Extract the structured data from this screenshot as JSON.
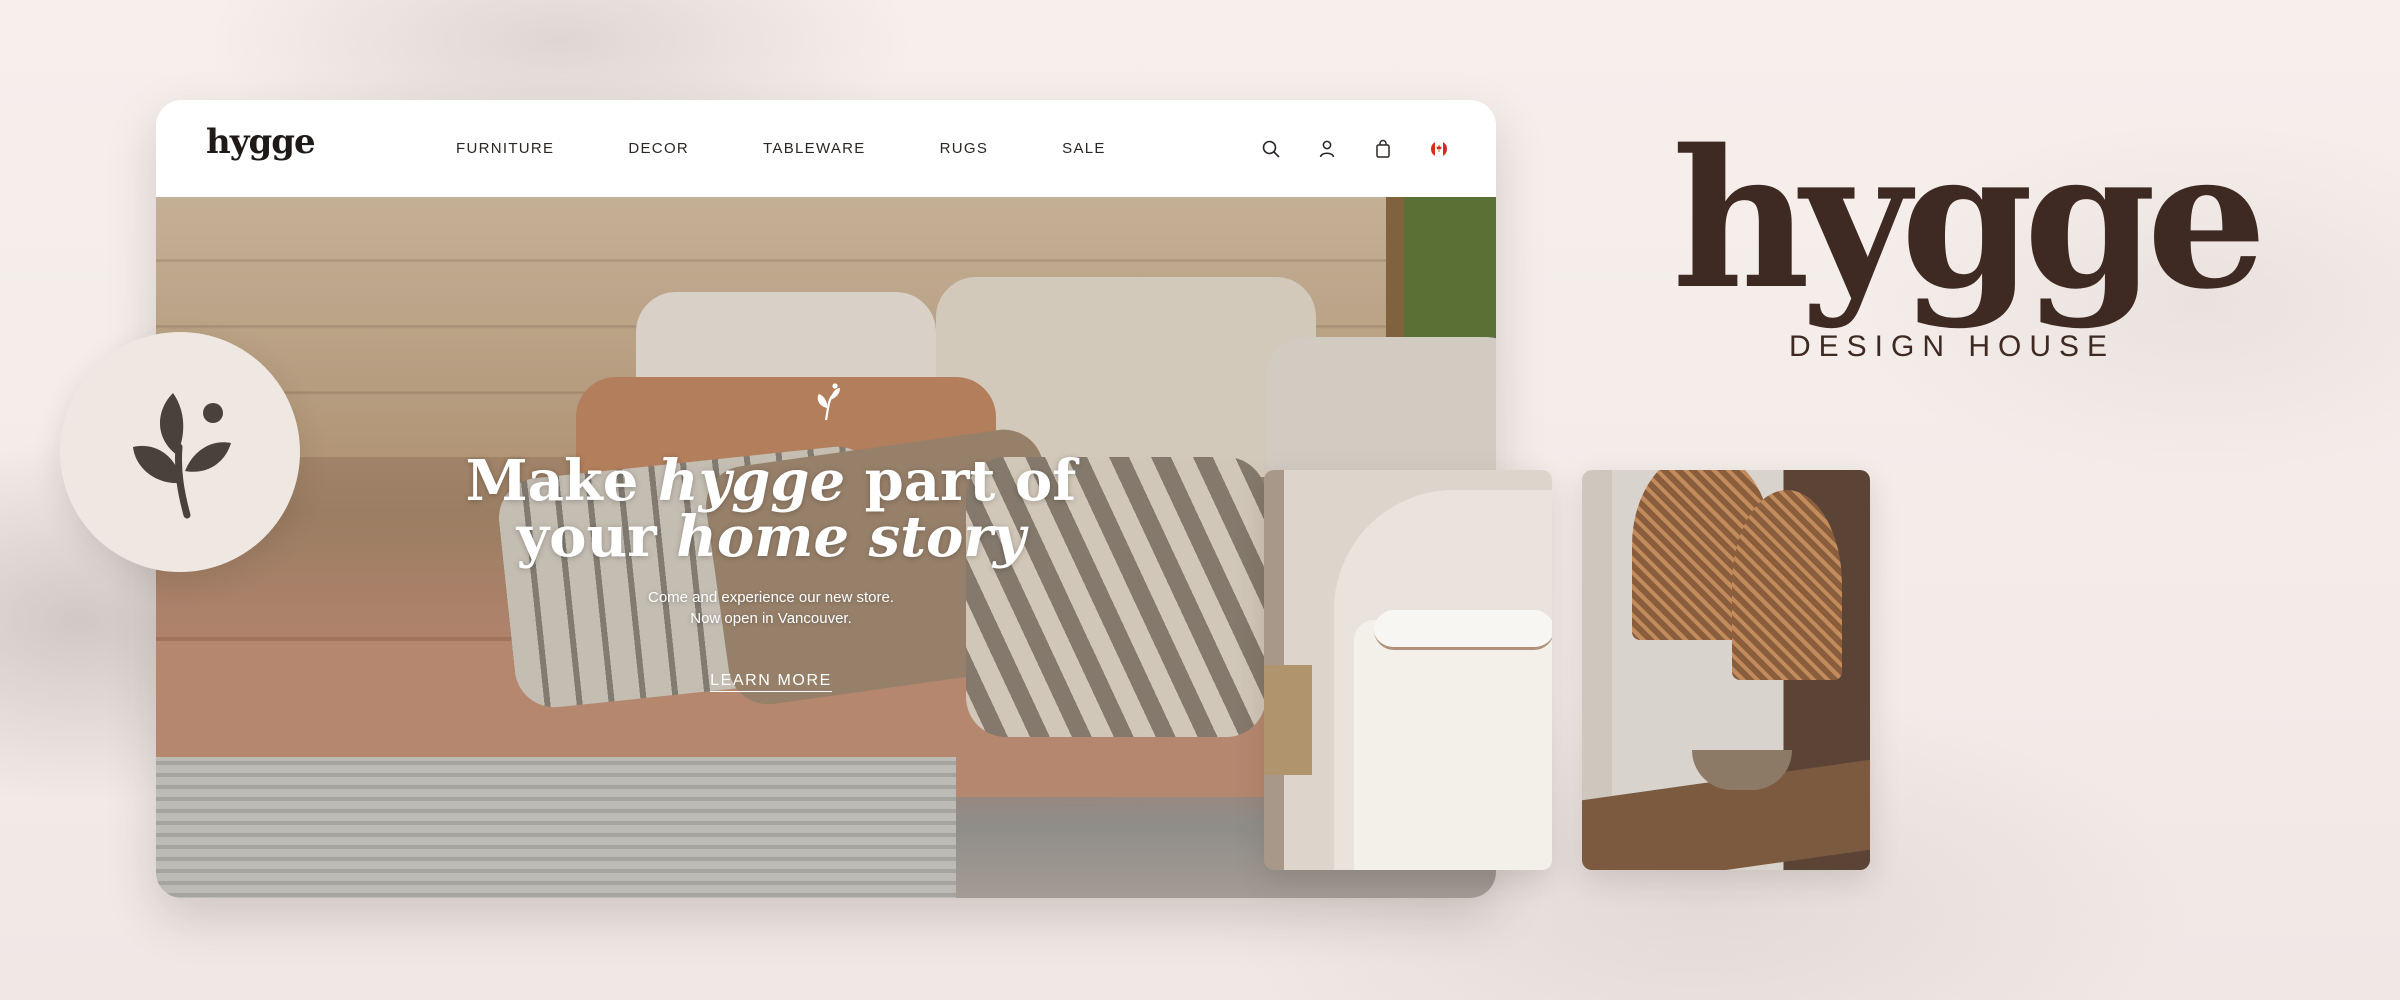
{
  "site": {
    "logo": "hygge",
    "nav": [
      "FURNITURE",
      "DECOR",
      "TABLEWARE",
      "RUGS",
      "SALE"
    ],
    "icons": [
      "search-icon",
      "account-icon",
      "bag-icon",
      "canada-flag-icon"
    ]
  },
  "hero": {
    "title_line1_a": "Make ",
    "title_line1_b": "hygge",
    "title_line1_c": " part of",
    "title_line2_a": "your ",
    "title_line2_b": "home story",
    "subtitle_line1": "Come and experience our new store.",
    "subtitle_line2": "Now open in Vancouver.",
    "cta": "LEARN MORE"
  },
  "brand": {
    "wordmark": "hygge",
    "tagline": "DESIGN HOUSE"
  },
  "colors": {
    "brand_brown": "#3e2a22",
    "emblem_bg": "#efe8e2",
    "background": "#f4ede9"
  }
}
